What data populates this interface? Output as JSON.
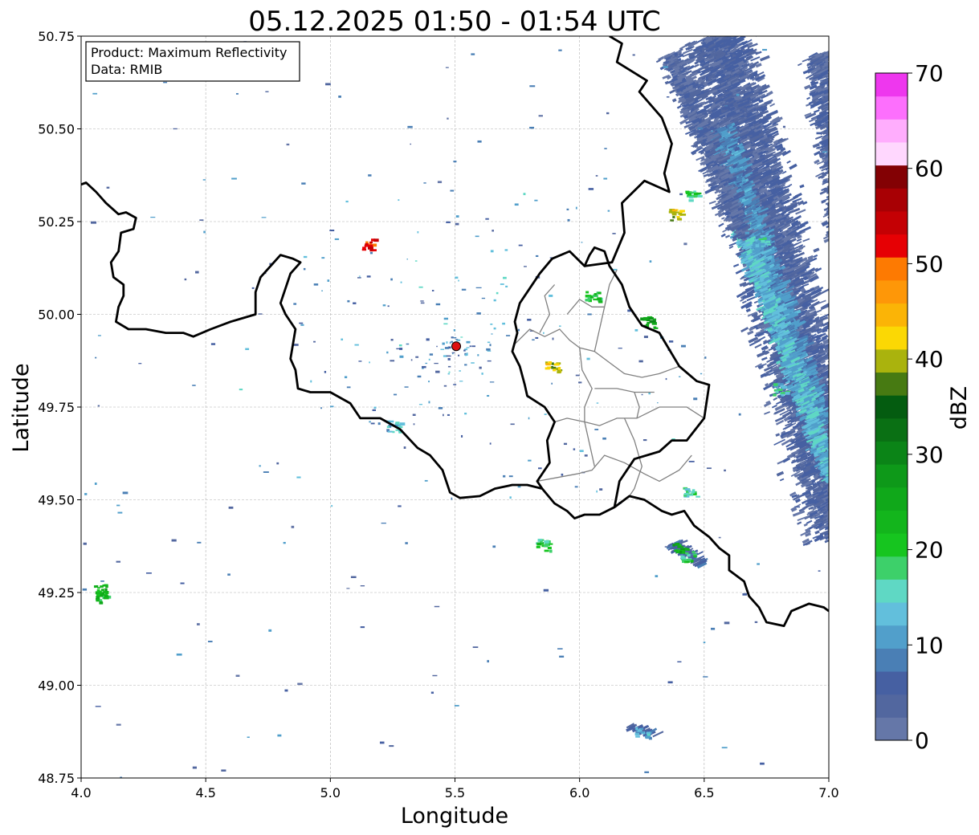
{
  "title": "05.12.2025 01:50 - 01:54 UTC",
  "info_box": {
    "product_line": "Product: Maximum Reflectivity",
    "data_line": "Data: RMIB"
  },
  "axes": {
    "xlabel": "Longitude",
    "ylabel": "Latitude",
    "xlim": [
      4.0,
      7.0
    ],
    "ylim": [
      48.75,
      50.75
    ],
    "xticks": [
      4.0,
      4.5,
      5.0,
      5.5,
      6.0,
      6.5,
      7.0
    ],
    "yticks": [
      48.75,
      49.0,
      49.25,
      49.5,
      49.75,
      50.0,
      50.25,
      50.5,
      50.75
    ],
    "xtick_labels": [
      "4.0",
      "4.5",
      "5.0",
      "5.5",
      "6.0",
      "6.5",
      "7.0"
    ],
    "ytick_labels": [
      "48.75",
      "49.00",
      "49.25",
      "49.50",
      "49.75",
      "50.00",
      "50.25",
      "50.50",
      "50.75"
    ],
    "grid": true
  },
  "colorbar": {
    "label": "dBZ",
    "vmin": 0,
    "vmax": 70,
    "tick_values": [
      0,
      10,
      20,
      30,
      40,
      50,
      60,
      70
    ],
    "tick_labels": [
      "0",
      "10",
      "20",
      "30",
      "40",
      "50",
      "60",
      "70"
    ],
    "colors": [
      "#6577a8",
      "#52679f",
      "#4660a2",
      "#4a7fb5",
      "#519fcb",
      "#62bfdc",
      "#5fd8c4",
      "#3dd06a",
      "#16c51f",
      "#13b51c",
      "#10a81a",
      "#0e9919",
      "#0b8417",
      "#0a7014",
      "#045c10",
      "#477a12",
      "#aab30d",
      "#fbd804",
      "#fbb406",
      "#fe9708",
      "#fd7a02",
      "#e60004",
      "#c40004",
      "#a80004",
      "#830104",
      "#ffd7fe",
      "#ffadfd",
      "#fd6ffd",
      "#ee37ee"
    ]
  },
  "radar_site": {
    "lon": 5.505,
    "lat": 49.914,
    "color": "#dd1010"
  },
  "borders": {
    "national": [
      [
        [
          4.0,
          50.35
        ],
        [
          4.02,
          50.355
        ],
        [
          4.06,
          50.33
        ],
        [
          4.1,
          50.3
        ],
        [
          4.15,
          50.27
        ],
        [
          4.18,
          50.275
        ],
        [
          4.22,
          50.26
        ],
        [
          4.21,
          50.23
        ],
        [
          4.16,
          50.22
        ],
        [
          4.15,
          50.17
        ],
        [
          4.12,
          50.14
        ],
        [
          4.13,
          50.1
        ],
        [
          4.17,
          50.08
        ],
        [
          4.17,
          50.05
        ],
        [
          4.15,
          50.02
        ],
        [
          4.14,
          49.98
        ],
        [
          4.19,
          49.96
        ],
        [
          4.26,
          49.96
        ],
        [
          4.34,
          49.95
        ],
        [
          4.41,
          49.95
        ],
        [
          4.45,
          49.94
        ],
        [
          4.52,
          49.96
        ],
        [
          4.6,
          49.98
        ],
        [
          4.65,
          49.99
        ],
        [
          4.7,
          50.0
        ],
        [
          4.7,
          50.06
        ],
        [
          4.72,
          50.1
        ],
        [
          4.8,
          50.16
        ],
        [
          4.85,
          50.15
        ],
        [
          4.88,
          50.14
        ],
        [
          4.84,
          50.11
        ],
        [
          4.8,
          50.03
        ],
        [
          4.82,
          50.0
        ],
        [
          4.86,
          49.96
        ],
        [
          4.85,
          49.92
        ],
        [
          4.84,
          49.88
        ],
        [
          4.86,
          49.85
        ],
        [
          4.87,
          49.8
        ],
        [
          4.92,
          49.79
        ],
        [
          5.0,
          49.79
        ],
        [
          5.08,
          49.76
        ],
        [
          5.12,
          49.72
        ],
        [
          5.2,
          49.72
        ],
        [
          5.28,
          49.69
        ],
        [
          5.35,
          49.64
        ],
        [
          5.4,
          49.62
        ],
        [
          5.45,
          49.58
        ],
        [
          5.48,
          49.52
        ],
        [
          5.52,
          49.505
        ],
        [
          5.6,
          49.51
        ],
        [
          5.66,
          49.53
        ],
        [
          5.73,
          49.54
        ],
        [
          5.79,
          49.54
        ],
        [
          5.85,
          49.53
        ],
        [
          5.9,
          49.49
        ],
        [
          5.95,
          49.47
        ],
        [
          5.98,
          49.45
        ],
        [
          6.02,
          49.46
        ],
        [
          6.08,
          49.46
        ],
        [
          6.14,
          49.48
        ],
        [
          6.2,
          49.51
        ],
        [
          6.26,
          49.5
        ],
        [
          6.33,
          49.47
        ],
        [
          6.37,
          49.46
        ],
        [
          6.42,
          49.47
        ],
        [
          6.46,
          49.43
        ],
        [
          6.52,
          49.4
        ],
        [
          6.56,
          49.37
        ],
        [
          6.6,
          49.35
        ],
        [
          6.6,
          49.31
        ],
        [
          6.66,
          49.28
        ],
        [
          6.68,
          49.24
        ],
        [
          6.72,
          49.21
        ],
        [
          6.75,
          49.17
        ],
        [
          6.82,
          49.16
        ],
        [
          6.85,
          49.2
        ],
        [
          6.92,
          49.22
        ],
        [
          6.98,
          49.21
        ],
        [
          7.0,
          49.2
        ]
      ],
      [
        [
          6.14,
          49.48
        ],
        [
          6.16,
          49.55
        ],
        [
          6.22,
          49.61
        ],
        [
          6.32,
          49.63
        ],
        [
          6.37,
          49.66
        ],
        [
          6.43,
          49.66
        ],
        [
          6.5,
          49.72
        ],
        [
          6.52,
          49.81
        ],
        [
          6.47,
          49.82
        ],
        [
          6.4,
          49.86
        ],
        [
          6.32,
          49.95
        ],
        [
          6.25,
          49.97
        ],
        [
          6.2,
          50.02
        ],
        [
          6.17,
          50.08
        ],
        [
          6.12,
          50.13
        ],
        [
          6.1,
          50.17
        ],
        [
          6.06,
          50.18
        ],
        [
          6.04,
          50.16
        ],
        [
          6.02,
          50.13
        ],
        [
          5.96,
          50.17
        ],
        [
          5.89,
          50.15
        ],
        [
          5.84,
          50.11
        ],
        [
          5.8,
          50.07
        ],
        [
          5.76,
          50.03
        ],
        [
          5.74,
          49.98
        ],
        [
          5.75,
          49.95
        ],
        [
          5.73,
          49.9
        ],
        [
          5.76,
          49.86
        ],
        [
          5.78,
          49.81
        ],
        [
          5.79,
          49.78
        ],
        [
          5.86,
          49.75
        ],
        [
          5.9,
          49.71
        ],
        [
          5.87,
          49.66
        ],
        [
          5.88,
          49.6
        ],
        [
          5.83,
          49.55
        ],
        [
          5.85,
          49.53
        ]
      ],
      [
        [
          6.02,
          50.13
        ],
        [
          6.13,
          50.14
        ],
        [
          6.18,
          50.22
        ],
        [
          6.17,
          50.3
        ],
        [
          6.26,
          50.36
        ],
        [
          6.36,
          50.33
        ],
        [
          6.34,
          50.38
        ],
        [
          6.37,
          50.46
        ],
        [
          6.33,
          50.53
        ],
        [
          6.24,
          50.6
        ],
        [
          6.27,
          50.63
        ],
        [
          6.15,
          50.68
        ],
        [
          6.17,
          50.73
        ],
        [
          6.12,
          50.75
        ]
      ]
    ],
    "regional": [
      [
        [
          5.9,
          49.71
        ],
        [
          5.95,
          49.72
        ],
        [
          6.02,
          49.71
        ],
        [
          6.08,
          49.7
        ],
        [
          6.15,
          49.72
        ],
        [
          6.23,
          49.72
        ],
        [
          6.32,
          49.75
        ],
        [
          6.43,
          49.75
        ],
        [
          6.5,
          49.72
        ]
      ],
      [
        [
          5.83,
          49.55
        ],
        [
          5.91,
          49.56
        ],
        [
          5.99,
          49.57
        ],
        [
          6.05,
          49.58
        ],
        [
          6.1,
          49.62
        ],
        [
          6.18,
          49.6
        ],
        [
          6.26,
          49.57
        ],
        [
          6.32,
          49.55
        ],
        [
          6.4,
          49.58
        ],
        [
          6.45,
          49.62
        ]
      ],
      [
        [
          6.02,
          49.71
        ],
        [
          6.04,
          49.65
        ],
        [
          6.06,
          49.59
        ]
      ],
      [
        [
          6.18,
          49.72
        ],
        [
          6.22,
          49.66
        ],
        [
          6.25,
          49.59
        ],
        [
          6.22,
          49.53
        ],
        [
          6.2,
          49.51
        ]
      ],
      [
        [
          5.74,
          49.92
        ],
        [
          5.8,
          49.96
        ],
        [
          5.86,
          49.94
        ],
        [
          5.92,
          49.96
        ],
        [
          5.96,
          49.93
        ],
        [
          6.0,
          49.91
        ],
        [
          6.06,
          49.9
        ],
        [
          6.12,
          49.87
        ],
        [
          6.18,
          49.84
        ],
        [
          6.25,
          49.83
        ],
        [
          6.32,
          49.84
        ],
        [
          6.4,
          49.86
        ]
      ],
      [
        [
          6.0,
          49.91
        ],
        [
          6.01,
          49.85
        ],
        [
          6.05,
          49.8
        ],
        [
          6.02,
          49.75
        ],
        [
          6.02,
          49.71
        ]
      ],
      [
        [
          6.06,
          49.9
        ],
        [
          6.08,
          49.96
        ],
        [
          6.1,
          50.02
        ],
        [
          6.12,
          50.08
        ],
        [
          6.15,
          50.12
        ]
      ],
      [
        [
          5.84,
          49.95
        ],
        [
          5.88,
          50.0
        ],
        [
          5.86,
          50.05
        ],
        [
          5.9,
          50.08
        ]
      ],
      [
        [
          6.06,
          49.8
        ],
        [
          6.15,
          49.8
        ],
        [
          6.22,
          49.79
        ],
        [
          6.3,
          49.79
        ]
      ],
      [
        [
          6.22,
          49.79
        ],
        [
          6.24,
          49.75
        ],
        [
          6.23,
          49.72
        ]
      ],
      [
        [
          5.95,
          50.0
        ],
        [
          6.0,
          50.04
        ],
        [
          6.05,
          50.02
        ],
        [
          6.1,
          50.02
        ]
      ]
    ]
  },
  "echoes": [
    {
      "lat": 50.75,
      "lon": 6.53,
      "lat2": 49.4,
      "lon2": 7.05,
      "width": 0.4,
      "dbz": 4
    },
    {
      "lat": 50.5,
      "lon": 6.55,
      "lat2": 49.7,
      "lon2": 6.95,
      "width": 0.14,
      "dbz": 10
    },
    {
      "lat": 50.25,
      "lon": 6.62,
      "lat2": 49.55,
      "lon2": 7.0,
      "width": 0.1,
      "dbz": 13
    },
    {
      "lat": 50.7,
      "lon": 6.95,
      "lat2": 50.2,
      "lon2": 7.05,
      "width": 0.18,
      "dbz": 4
    },
    {
      "lat": 50.7,
      "lon": 6.35,
      "lat2": 50.2,
      "lon2": 6.65,
      "width": 0.14,
      "dbz": 3
    },
    {
      "lat": 49.38,
      "lon": 6.35,
      "lat2": 49.33,
      "lon2": 6.48,
      "width": 0.06,
      "dbz": 6
    },
    {
      "lat": 48.89,
      "lon": 6.18,
      "lat2": 48.86,
      "lon2": 6.3,
      "width": 0.03,
      "dbz": 6
    }
  ],
  "cells": [
    {
      "lon": 6.4,
      "lat": 49.37,
      "dbz": 24
    },
    {
      "lon": 6.43,
      "lat": 49.35,
      "dbz": 20
    },
    {
      "lon": 6.25,
      "lat": 48.875,
      "dbz": 13
    },
    {
      "lon": 6.8,
      "lat": 49.8,
      "dbz": 14
    },
    {
      "lon": 6.73,
      "lat": 50.2,
      "dbz": 14
    },
    {
      "lon": 6.45,
      "lat": 50.32,
      "dbz": 18
    },
    {
      "lon": 6.38,
      "lat": 50.27,
      "dbz": 40
    },
    {
      "lon": 5.155,
      "lat": 50.19,
      "dbz": 52
    },
    {
      "lon": 5.25,
      "lat": 49.7,
      "dbz": 12
    },
    {
      "lon": 4.08,
      "lat": 49.24,
      "dbz": 22
    },
    {
      "lon": 4.07,
      "lat": 49.26,
      "dbz": 24
    },
    {
      "lon": 5.89,
      "lat": 49.86,
      "dbz": 40
    },
    {
      "lon": 6.27,
      "lat": 49.98,
      "dbz": 26
    },
    {
      "lon": 6.05,
      "lat": 50.05,
      "dbz": 20
    },
    {
      "lon": 6.44,
      "lat": 49.52,
      "dbz": 16
    },
    {
      "lon": 5.85,
      "lat": 49.38,
      "dbz": 18
    }
  ]
}
